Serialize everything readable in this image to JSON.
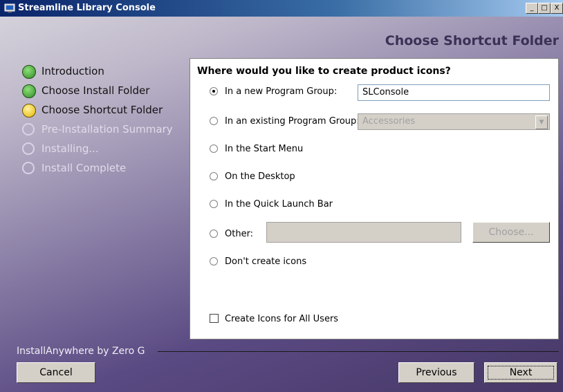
{
  "window": {
    "title": "Streamline Library Console",
    "minimize_label": "_",
    "maximize_label": "□",
    "close_label": "X"
  },
  "header": {
    "title": "Choose Shortcut Folder"
  },
  "steps": [
    {
      "label": "Introduction",
      "state": "done"
    },
    {
      "label": "Choose Install Folder",
      "state": "done"
    },
    {
      "label": "Choose Shortcut Folder",
      "state": "current"
    },
    {
      "label": "Pre-Installation Summary",
      "state": "pending"
    },
    {
      "label": "Installing...",
      "state": "pending"
    },
    {
      "label": "Install Complete",
      "state": "pending"
    }
  ],
  "panel": {
    "question": "Where would you like to create product icons?",
    "options": [
      {
        "label": "In a new Program Group:",
        "selected": true
      },
      {
        "label": "In an existing Program Group:",
        "selected": false
      },
      {
        "label": "In the Start Menu",
        "selected": false
      },
      {
        "label": "On the Desktop",
        "selected": false
      },
      {
        "label": "In the Quick Launch Bar",
        "selected": false
      },
      {
        "label": "Other:",
        "selected": false
      },
      {
        "label": "Don't create icons",
        "selected": false
      }
    ],
    "new_group_value": "SLConsole",
    "existing_group_value": "Accessories",
    "other_path_value": "",
    "choose_button": "Choose...",
    "all_users_label": "Create Icons for All Users",
    "all_users_checked": false
  },
  "footer": {
    "vendor": "InstallAnywhere by Zero G",
    "cancel": "Cancel",
    "previous": "Previous",
    "next": "Next"
  },
  "colors": {
    "title_bar": "#0a246a",
    "header_text": "#3a3155",
    "done_icon": "#2f8a23",
    "current_icon": "#e3b500"
  }
}
